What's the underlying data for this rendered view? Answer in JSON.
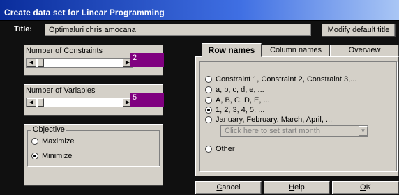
{
  "window": {
    "title": "Create data set for Linear Programming"
  },
  "title_row": {
    "label": "Title:",
    "value": "Optimaluri chris amocana",
    "modify_button": "Modify default title"
  },
  "constraints": {
    "label": "Number of Constraints",
    "value": "2",
    "slider_fraction": 0.02
  },
  "variables": {
    "label": "Number of Variables",
    "value": "5",
    "slider_fraction": 0.02
  },
  "objective": {
    "legend": "Objective",
    "options": [
      {
        "label": "Maximize",
        "selected": false
      },
      {
        "label": "Minimize",
        "selected": true
      }
    ]
  },
  "tabs": [
    {
      "label": "Row names",
      "active": true
    },
    {
      "label": "Column names",
      "active": false
    },
    {
      "label": "Overview",
      "active": false
    }
  ],
  "row_names": {
    "options": [
      {
        "label": "Constraint 1, Constraint 2, Constraint 3,...",
        "selected": false
      },
      {
        "label": "a, b, c, d, e, ...",
        "selected": false
      },
      {
        "label": "A, B, C, D, E, ...",
        "selected": false
      },
      {
        "label": "1, 2, 3, 4, 5, ...",
        "selected": true
      },
      {
        "label": "January, February, March, April, ...",
        "selected": false
      }
    ],
    "month_combo_placeholder": "Click here to set start month",
    "other_label": "Other"
  },
  "buttons": {
    "cancel_first": "C",
    "cancel_rest": "ancel",
    "help_first": "H",
    "help_rest": "elp",
    "ok_first": "O",
    "ok_rest": "K"
  },
  "colors": {
    "value_box": "#800080",
    "face": "#d4d0c8",
    "titlebar": "#0a2d9c"
  },
  "icons": [
    "scroll-left-arrow-icon",
    "scroll-right-arrow-icon",
    "dropdown-arrow-icon"
  ]
}
